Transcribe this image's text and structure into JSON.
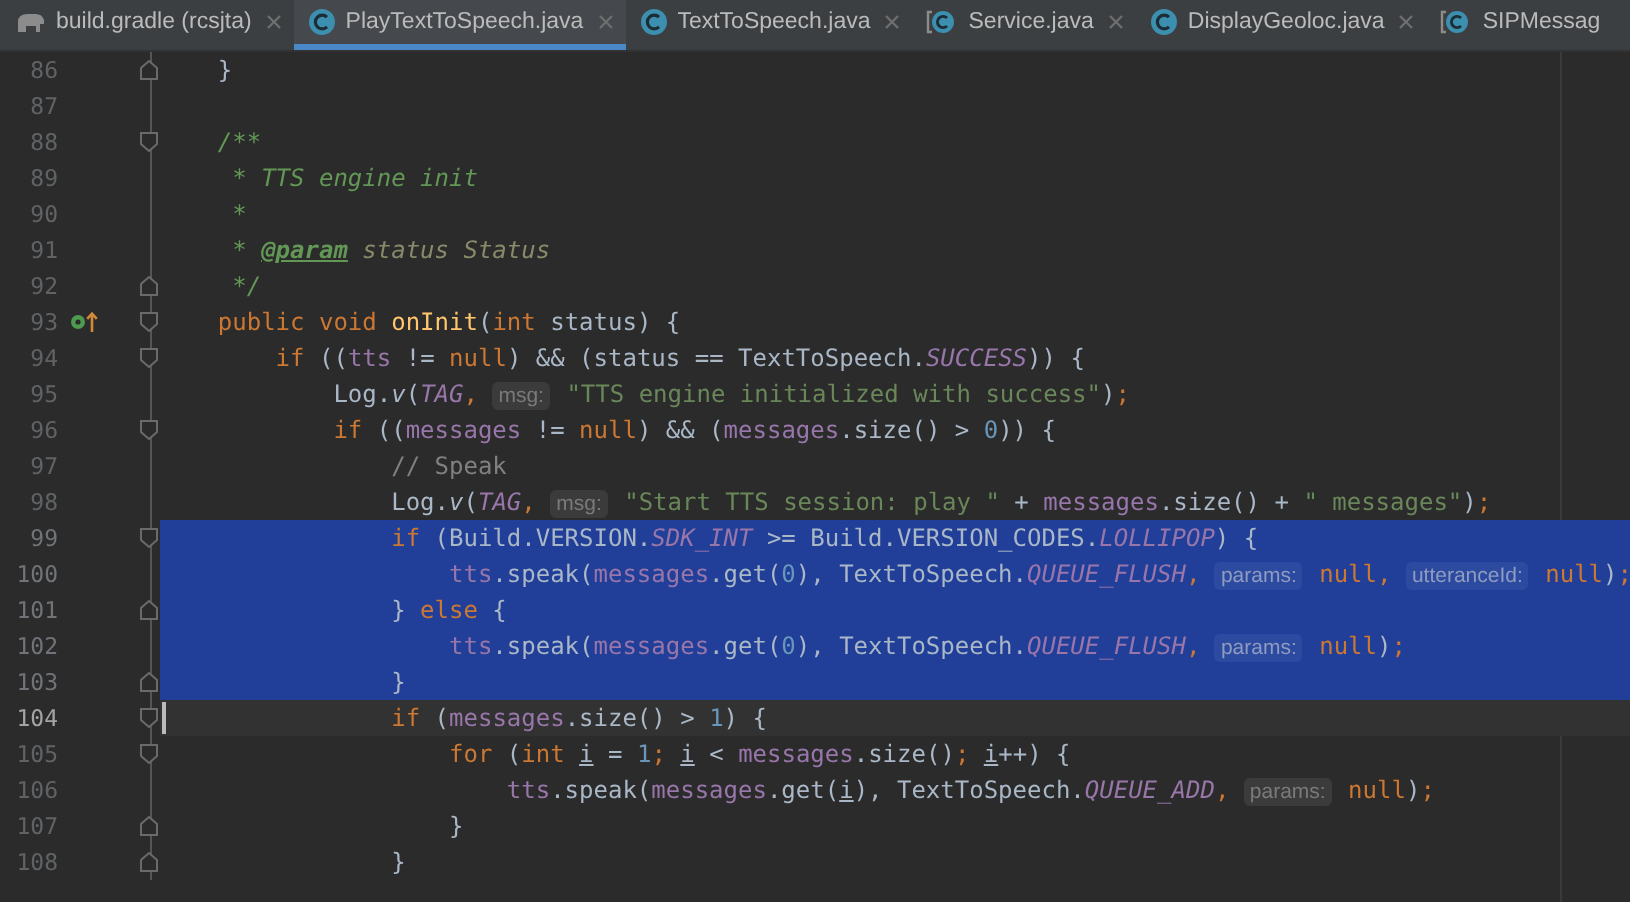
{
  "tabs": [
    {
      "label": "build.gradle (rcsjta)",
      "kind": "gradle",
      "selected": false,
      "closable": true
    },
    {
      "label": "PlayTextToSpeech.java",
      "kind": "class",
      "selected": true,
      "closable": true
    },
    {
      "label": "TextToSpeech.java",
      "kind": "class",
      "selected": false,
      "closable": true
    },
    {
      "label": "Service.java",
      "kind": "abstract",
      "selected": false,
      "closable": true
    },
    {
      "label": "DisplayGeoloc.java",
      "kind": "class",
      "selected": false,
      "closable": true
    },
    {
      "label": "SIPMessag",
      "kind": "abstract",
      "selected": false,
      "closable": false
    }
  ],
  "lines": [
    {
      "num": "86",
      "fold": {
        "kind": "end"
      },
      "selected": false,
      "current": false,
      "tokens": [
        {
          "t": "    }",
          "kind": "plain"
        }
      ]
    },
    {
      "num": "87",
      "selected": false,
      "current": false
    },
    {
      "num": "88",
      "fold": {
        "kind": "start"
      },
      "selected": false,
      "current": false,
      "tokens": [
        {
          "t": "    /**",
          "kind": "doc"
        }
      ]
    },
    {
      "num": "89",
      "selected": false,
      "current": false,
      "tokens": [
        {
          "t": "     * TTS engine init",
          "kind": "doc"
        }
      ]
    },
    {
      "num": "90",
      "selected": false,
      "current": false,
      "tokens": [
        {
          "t": "     *",
          "kind": "doc"
        }
      ]
    },
    {
      "num": "91",
      "selected": false,
      "current": false,
      "tokens": [
        {
          "t": "     * ",
          "kind": "doc"
        },
        {
          "t": "@param",
          "kind": "doctag"
        },
        {
          "t": " status Status",
          "kind": "docparam"
        }
      ]
    },
    {
      "num": "92",
      "fold": {
        "kind": "end"
      },
      "selected": false,
      "current": false,
      "tokens": [
        {
          "t": "     */",
          "kind": "doc"
        }
      ]
    },
    {
      "num": "93",
      "fold": {
        "kind": "start"
      },
      "marker": {
        "kind": "implements"
      },
      "selected": false,
      "current": false,
      "tokens": [
        {
          "t": "    public void ",
          "kind": "keyword"
        },
        {
          "t": "onInit",
          "kind": "method"
        },
        {
          "t": "(",
          "kind": "plain"
        },
        {
          "t": "int",
          "kind": "keyword"
        },
        {
          "t": " status) {",
          "kind": "plain"
        }
      ]
    },
    {
      "num": "94",
      "fold": {
        "kind": "start"
      },
      "selected": false,
      "current": false,
      "tokens": [
        {
          "t": "        if ",
          "kind": "keyword"
        },
        {
          "t": "((",
          "kind": "plain"
        },
        {
          "t": "tts",
          "kind": "field"
        },
        {
          "t": " != ",
          "kind": "plain"
        },
        {
          "t": "null",
          "kind": "keyword"
        },
        {
          "t": ") && (status == TextToSpeech.",
          "kind": "plain"
        },
        {
          "t": "SUCCESS",
          "kind": "constant"
        },
        {
          "t": ")) {",
          "kind": "plain"
        }
      ]
    },
    {
      "num": "95",
      "selected": false,
      "current": false,
      "tokens": [
        {
          "t": "            Log.",
          "kind": "plain"
        },
        {
          "t": "v",
          "kind": "italic"
        },
        {
          "t": "(",
          "kind": "plain"
        },
        {
          "t": "TAG",
          "kind": "constant"
        },
        {
          "t": ", ",
          "kind": "keyword"
        },
        {
          "t": "msg:",
          "kind": "hint"
        },
        {
          "t": " \"TTS engine initialized with success\"",
          "kind": "string"
        },
        {
          "t": ")",
          "kind": "plain"
        },
        {
          "t": ";",
          "kind": "keyword"
        }
      ]
    },
    {
      "num": "96",
      "fold": {
        "kind": "start"
      },
      "selected": false,
      "current": false,
      "tokens": [
        {
          "t": "            if ",
          "kind": "keyword"
        },
        {
          "t": "((",
          "kind": "plain"
        },
        {
          "t": "messages",
          "kind": "field"
        },
        {
          "t": " != ",
          "kind": "plain"
        },
        {
          "t": "null",
          "kind": "keyword"
        },
        {
          "t": ") && (",
          "kind": "plain"
        },
        {
          "t": "messages",
          "kind": "field"
        },
        {
          "t": ".size() > ",
          "kind": "plain"
        },
        {
          "t": "0",
          "kind": "number"
        },
        {
          "t": ")) {",
          "kind": "plain"
        }
      ]
    },
    {
      "num": "97",
      "selected": false,
      "current": false,
      "tokens": [
        {
          "t": "                // Speak",
          "kind": "comment"
        }
      ]
    },
    {
      "num": "98",
      "selected": false,
      "current": false,
      "tokens": [
        {
          "t": "                Log.",
          "kind": "plain"
        },
        {
          "t": "v",
          "kind": "italic"
        },
        {
          "t": "(",
          "kind": "plain"
        },
        {
          "t": "TAG",
          "kind": "constant"
        },
        {
          "t": ", ",
          "kind": "keyword"
        },
        {
          "t": "msg:",
          "kind": "hint"
        },
        {
          "t": " \"Start TTS session: play \"",
          "kind": "string"
        },
        {
          "t": " + ",
          "kind": "plain"
        },
        {
          "t": "messages",
          "kind": "field"
        },
        {
          "t": ".size() + ",
          "kind": "plain"
        },
        {
          "t": "\" messages\"",
          "kind": "string"
        },
        {
          "t": ")",
          "kind": "plain"
        },
        {
          "t": ";",
          "kind": "keyword"
        }
      ]
    },
    {
      "num": "99",
      "fold": {
        "kind": "start"
      },
      "selected": true,
      "current": false,
      "tokens": [
        {
          "t": "                if ",
          "kind": "keyword"
        },
        {
          "t": "(Build.VERSION.",
          "kind": "plain"
        },
        {
          "t": "SDK_INT",
          "kind": "constant"
        },
        {
          "t": " >= Build.VERSION_CODES.",
          "kind": "plain"
        },
        {
          "t": "LOLLIPOP",
          "kind": "constant"
        },
        {
          "t": ") {",
          "kind": "plain"
        }
      ]
    },
    {
      "num": "100",
      "selected": true,
      "current": false,
      "tokens": [
        {
          "t": "                    tts",
          "kind": "field"
        },
        {
          "t": ".speak(",
          "kind": "plain"
        },
        {
          "t": "messages",
          "kind": "field"
        },
        {
          "t": ".get(",
          "kind": "plain"
        },
        {
          "t": "0",
          "kind": "number"
        },
        {
          "t": "), TextToSpeech.",
          "kind": "plain"
        },
        {
          "t": "QUEUE_FLUSH",
          "kind": "constant"
        },
        {
          "t": ", ",
          "kind": "keyword"
        },
        {
          "t": "params:",
          "kind": "hint"
        },
        {
          "t": " null, ",
          "kind": "keyword"
        },
        {
          "t": "utteranceId:",
          "kind": "hint"
        },
        {
          "t": " null",
          "kind": "keyword"
        },
        {
          "t": ")",
          "kind": "plain"
        },
        {
          "t": ";",
          "kind": "keyword"
        }
      ]
    },
    {
      "num": "101",
      "fold": {
        "kind": "end"
      },
      "selected": true,
      "current": false,
      "tokens": [
        {
          "t": "                } ",
          "kind": "plain"
        },
        {
          "t": "else ",
          "kind": "keyword"
        },
        {
          "t": "{",
          "kind": "plain"
        }
      ]
    },
    {
      "num": "102",
      "selected": true,
      "current": false,
      "tokens": [
        {
          "t": "                    tts",
          "kind": "field"
        },
        {
          "t": ".speak(",
          "kind": "plain"
        },
        {
          "t": "messages",
          "kind": "field"
        },
        {
          "t": ".get(",
          "kind": "plain"
        },
        {
          "t": "0",
          "kind": "number"
        },
        {
          "t": "), TextToSpeech.",
          "kind": "plain"
        },
        {
          "t": "QUEUE_FLUSH",
          "kind": "constant"
        },
        {
          "t": ", ",
          "kind": "keyword"
        },
        {
          "t": "params:",
          "kind": "hint"
        },
        {
          "t": " null",
          "kind": "keyword"
        },
        {
          "t": ")",
          "kind": "plain"
        },
        {
          "t": ";",
          "kind": "keyword"
        }
      ]
    },
    {
      "num": "103",
      "fold": {
        "kind": "end"
      },
      "selected": true,
      "current": false,
      "tokens": [
        {
          "t": "                }",
          "kind": "plain"
        }
      ]
    },
    {
      "num": "104",
      "fold": {
        "kind": "start"
      },
      "selected": false,
      "current": true,
      "tokens": [
        {
          "t": "                if ",
          "kind": "keyword"
        },
        {
          "t": "(",
          "kind": "plain"
        },
        {
          "t": "messages",
          "kind": "field"
        },
        {
          "t": ".size() > ",
          "kind": "plain"
        },
        {
          "t": "1",
          "kind": "number"
        },
        {
          "t": ") {",
          "kind": "plain"
        }
      ]
    },
    {
      "num": "105",
      "fold": {
        "kind": "start"
      },
      "selected": false,
      "current": false,
      "tokens": [
        {
          "t": "                    for ",
          "kind": "keyword"
        },
        {
          "t": "(",
          "kind": "plain"
        },
        {
          "t": "int ",
          "kind": "keyword"
        },
        {
          "t": "i",
          "kind": "underlined"
        },
        {
          "t": " = ",
          "kind": "plain"
        },
        {
          "t": "1",
          "kind": "number"
        },
        {
          "t": "; ",
          "kind": "keyword"
        },
        {
          "t": "i",
          "kind": "underlined"
        },
        {
          "t": " < ",
          "kind": "plain"
        },
        {
          "t": "messages",
          "kind": "field"
        },
        {
          "t": ".size()",
          "kind": "plain"
        },
        {
          "t": "; ",
          "kind": "keyword"
        },
        {
          "t": "i",
          "kind": "underlined"
        },
        {
          "t": "++) {",
          "kind": "plain"
        }
      ]
    },
    {
      "num": "106",
      "selected": false,
      "current": false,
      "tokens": [
        {
          "t": "                        tts",
          "kind": "field"
        },
        {
          "t": ".speak(",
          "kind": "plain"
        },
        {
          "t": "messages",
          "kind": "field"
        },
        {
          "t": ".get(",
          "kind": "plain"
        },
        {
          "t": "i",
          "kind": "underlined"
        },
        {
          "t": "), TextToSpeech.",
          "kind": "plain"
        },
        {
          "t": "QUEUE_ADD",
          "kind": "constant"
        },
        {
          "t": ", ",
          "kind": "keyword"
        },
        {
          "t": "params:",
          "kind": "hint"
        },
        {
          "t": " null",
          "kind": "keyword"
        },
        {
          "t": ")",
          "kind": "plain"
        },
        {
          "t": ";",
          "kind": "keyword"
        }
      ]
    },
    {
      "num": "107",
      "fold": {
        "kind": "end"
      },
      "selected": false,
      "current": false,
      "tokens": [
        {
          "t": "                    }",
          "kind": "plain"
        }
      ]
    },
    {
      "num": "108",
      "fold": {
        "kind": "end"
      },
      "selected": false,
      "current": false,
      "tokens": [
        {
          "t": "                }",
          "kind": "plain"
        }
      ]
    }
  ]
}
